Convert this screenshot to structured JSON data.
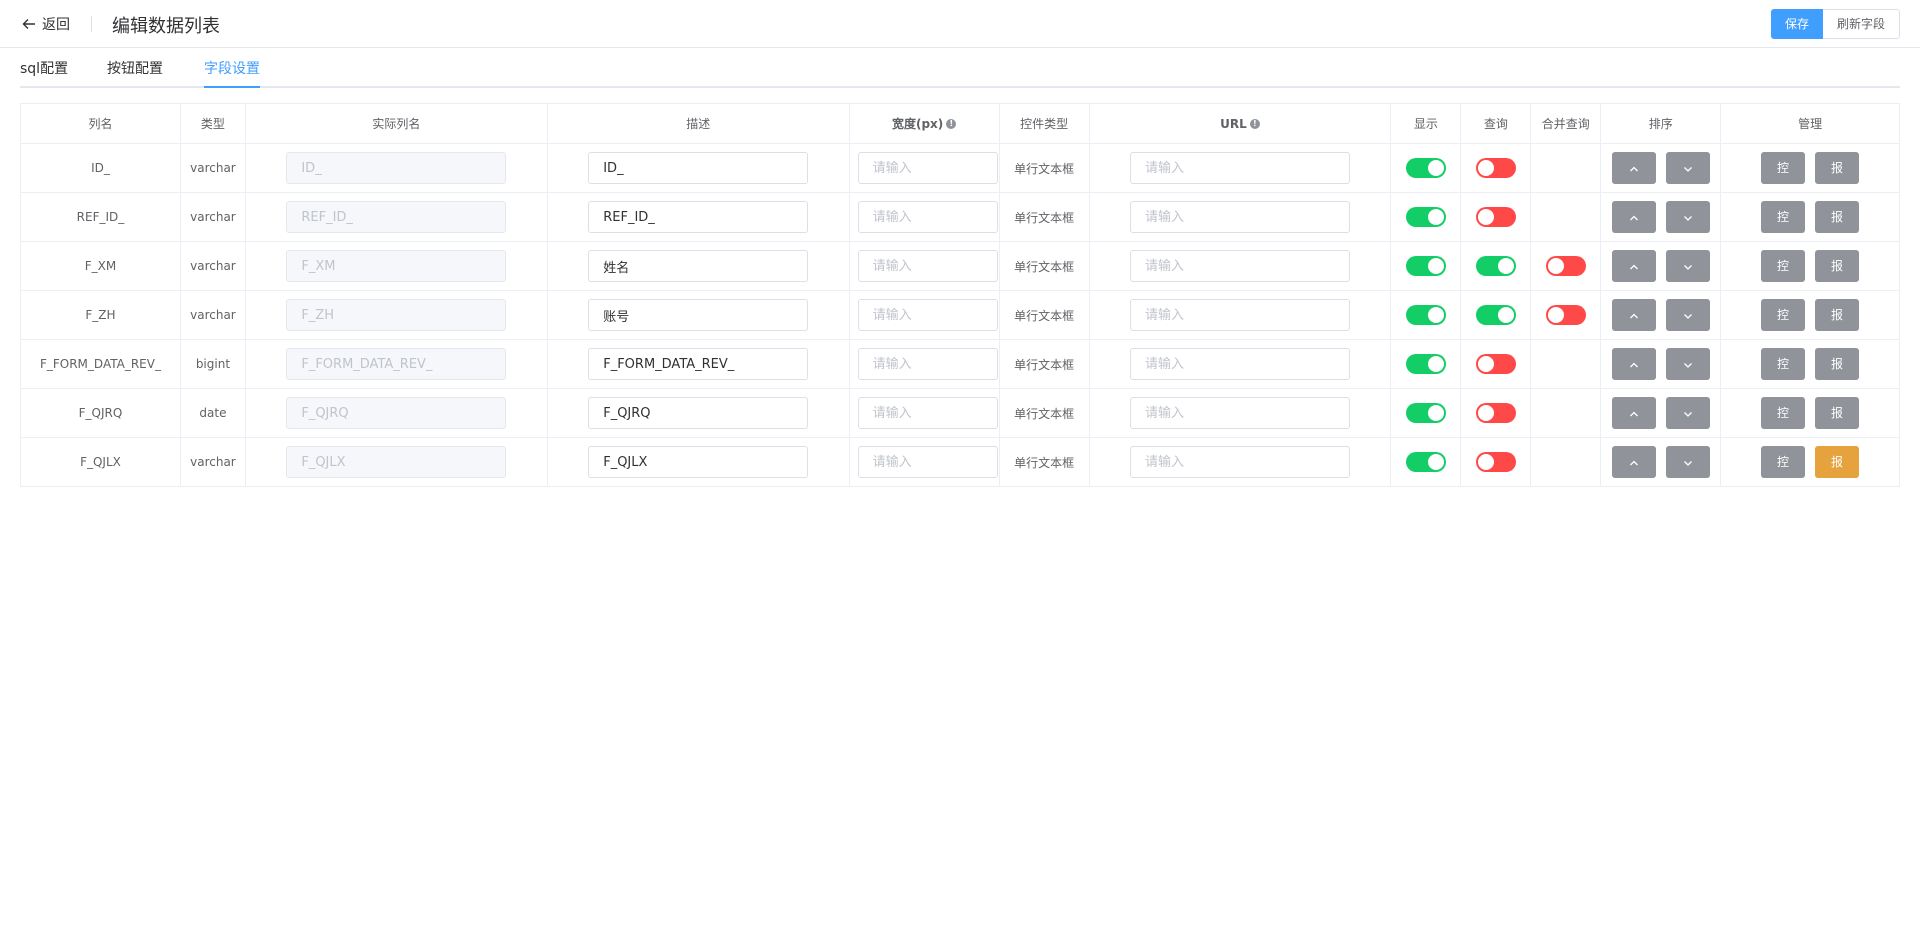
{
  "header": {
    "back_label": "返回",
    "title": "编辑数据列表",
    "save_label": "保存",
    "refresh_label": "刷新字段"
  },
  "tabs": [
    {
      "label": "sql配置"
    },
    {
      "label": "按钮配置"
    },
    {
      "label": "字段设置"
    }
  ],
  "table": {
    "headers": {
      "col_name": "列名",
      "type": "类型",
      "real_name": "实际列名",
      "desc": "描述",
      "width": "宽度(px)",
      "control_type": "控件类型",
      "url": "URL",
      "show": "显示",
      "query": "查询",
      "merge_query": "合并查询",
      "sort": "排序",
      "manage": "管理"
    },
    "placeholder": "请输入",
    "control_label": "单行文本框",
    "control_btn": "控",
    "report_btn": "报",
    "rows": [
      {
        "name": "ID_",
        "type": "varchar",
        "real": "ID_",
        "desc": "ID_",
        "show": true,
        "query": false,
        "merge": null,
        "report_warn": false
      },
      {
        "name": "REF_ID_",
        "type": "varchar",
        "real": "REF_ID_",
        "desc": "REF_ID_",
        "show": true,
        "query": false,
        "merge": null,
        "report_warn": false
      },
      {
        "name": "F_XM",
        "type": "varchar",
        "real": "F_XM",
        "desc": "姓名",
        "show": true,
        "query": true,
        "merge": false,
        "report_warn": false
      },
      {
        "name": "F_ZH",
        "type": "varchar",
        "real": "F_ZH",
        "desc": "账号",
        "show": true,
        "query": true,
        "merge": false,
        "report_warn": false
      },
      {
        "name": "F_FORM_DATA_REV_",
        "type": "bigint",
        "real": "F_FORM_DATA_REV_",
        "desc": "F_FORM_DATA_REV_",
        "show": true,
        "query": false,
        "merge": null,
        "report_warn": false
      },
      {
        "name": "F_QJRQ",
        "type": "date",
        "real": "F_QJRQ",
        "desc": "F_QJRQ",
        "show": true,
        "query": false,
        "merge": null,
        "report_warn": false
      },
      {
        "name": "F_QJLX",
        "type": "varchar",
        "real": "F_QJLX",
        "desc": "F_QJLX",
        "show": true,
        "query": false,
        "merge": null,
        "report_warn": true
      }
    ]
  },
  "colors": {
    "primary": "#409eff",
    "switch_on": "#13ce66",
    "switch_off": "#ff4949",
    "gray_btn": "#909399",
    "warn_btn": "#e6a23c"
  }
}
